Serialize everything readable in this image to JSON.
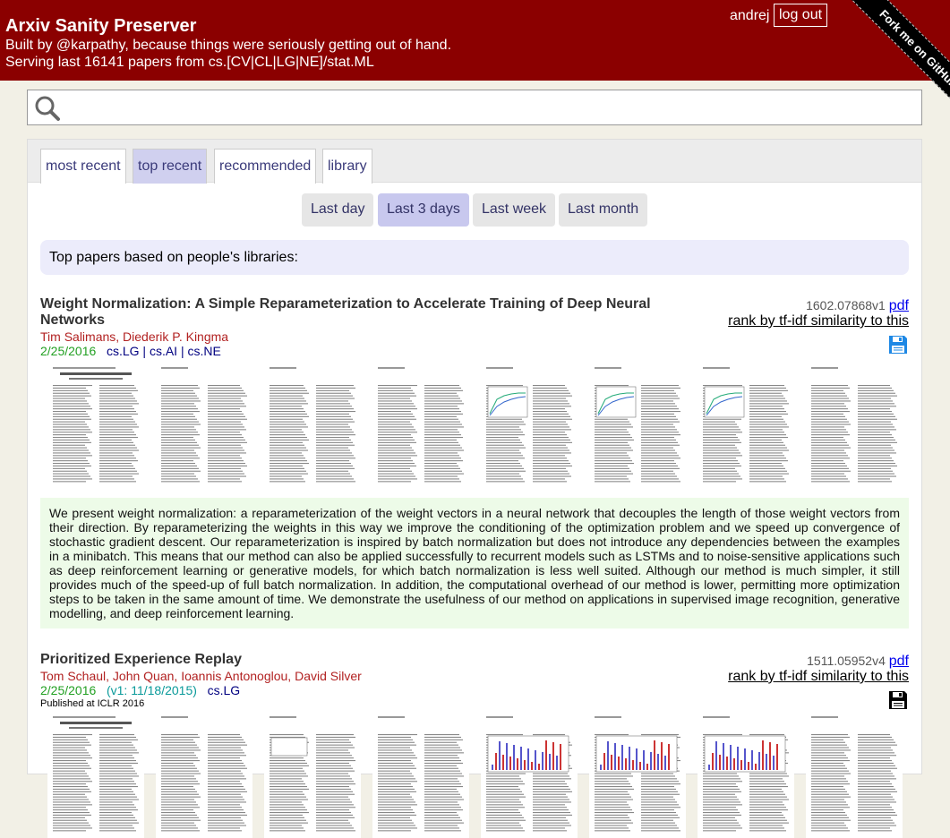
{
  "header": {
    "title": "Arxiv Sanity Preserver",
    "tagline": "Built by @karpathy, because things were seriously getting out of hand.",
    "serving": "Serving last 16141 papers from cs.[CV|CL|LG|NE]/stat.ML",
    "username": "andrej",
    "logout_label": "log out",
    "fork_label": "Fork me on GitHub"
  },
  "search": {
    "value": "",
    "placeholder": ""
  },
  "tabs": [
    {
      "label": "most recent",
      "active": false
    },
    {
      "label": "top recent",
      "active": true
    },
    {
      "label": "recommended",
      "active": false
    },
    {
      "label": "library",
      "active": false
    }
  ],
  "time_filters": [
    {
      "label": "Last day",
      "active": false
    },
    {
      "label": "Last 3 days",
      "active": true
    },
    {
      "label": "Last week",
      "active": false
    },
    {
      "label": "Last month",
      "active": false
    }
  ],
  "info_text": "Top papers based on people's libraries:",
  "papers": [
    {
      "title": "Weight Normalization: A Simple Reparameterization to Accelerate Training of Deep Neural Networks",
      "authors": "Tim Salimans, Diederik P. Kingma",
      "date": "2/25/2016",
      "v1": "",
      "categories": "cs.LG | cs.AI | cs.NE",
      "published": "",
      "arxiv_id": "1602.07868v1",
      "pdf_label": "pdf",
      "rank_label": "rank by tf-idf similarity to this",
      "saved": true,
      "abstract": "We present weight normalization: a reparameterization of the weight vectors in a neural network that decouples the length of those weight vectors from their direction. By reparameterizing the weights in this way we improve the conditioning of the optimization problem and we speed up convergence of stochastic gradient descent. Our reparameterization is inspired by batch normalization but does not introduce any dependencies between the examples in a minibatch. This means that our method can also be applied successfully to recurrent models such as LSTMs and to noise-sensitive applications such as deep reinforcement learning or generative models, for which batch normalization is less well suited. Although our method is much simpler, it still provides much of the speed-up of full batch normalization. In addition, the computational overhead of our method is lower, permitting more optimization steps to be taken in the same amount of time. We demonstrate the usefulness of our method on applications in supervised image recognition, generative modelling, and deep reinforcement learning.",
      "colors": {
        "save_icon": "#1e88e5"
      }
    },
    {
      "title": "Prioritized Experience Replay",
      "authors": "Tom Schaul, John Quan, Ioannis Antonoglou, David Silver",
      "date": "2/25/2016",
      "v1": "(v1: 11/18/2015)",
      "categories": "cs.LG",
      "published": "Published at ICLR 2016",
      "arxiv_id": "1511.05952v4",
      "pdf_label": "pdf",
      "rank_label": "rank by tf-idf similarity to this",
      "saved": false,
      "abstract": "",
      "colors": {
        "save_icon": "#000000"
      }
    }
  ],
  "colors": {
    "header_bg": "#8b0000",
    "page_bg": "#f2f0e6",
    "active_tab": "#d0d0ef",
    "abstract_bg": "#edfbe8"
  }
}
